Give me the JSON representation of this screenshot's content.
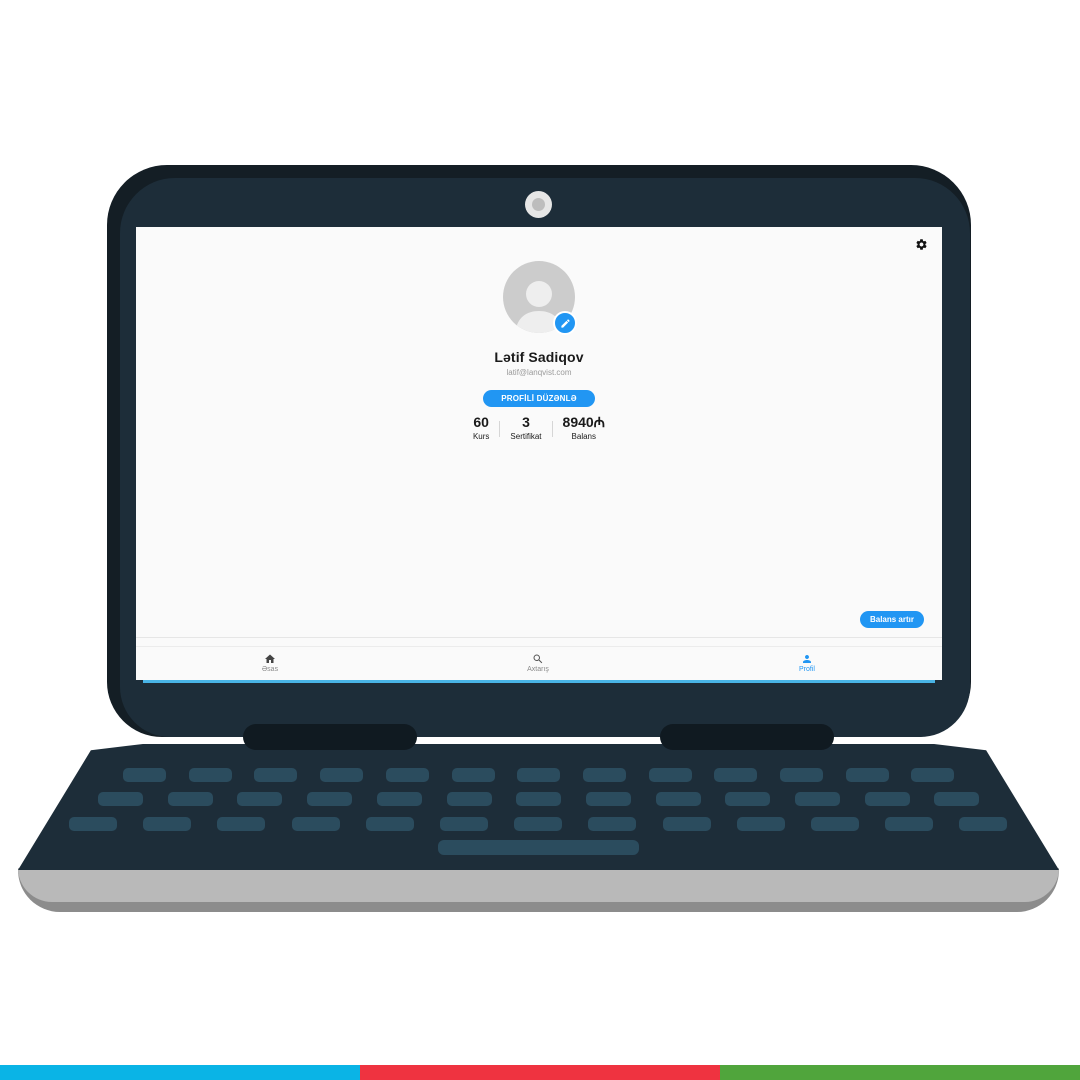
{
  "app": {
    "profile": {
      "name": "Lətif Sadiqov",
      "email": "latif@lanqvist.com",
      "edit_profile_label": "PROFİLİ DÜZƏNLƏ"
    },
    "stats": [
      {
        "value": "60",
        "label": "Kurs"
      },
      {
        "value": "3",
        "label": "Sertifikat"
      },
      {
        "value": "8940₼",
        "label": "Balans"
      }
    ],
    "add_balance_label": "Balans artır",
    "nav": [
      {
        "label": "Əsas",
        "icon": "home-icon",
        "active": false
      },
      {
        "label": "Axtarış",
        "icon": "search-icon",
        "active": false
      },
      {
        "label": "Profil",
        "icon": "person-icon",
        "active": true
      }
    ],
    "settings_icon": "gear-icon"
  },
  "colors": {
    "accent": "#2196f3",
    "laptop_body": "#1d2d39",
    "bar": [
      "#0ab4e6",
      "#ef3340",
      "#50a53c"
    ]
  }
}
